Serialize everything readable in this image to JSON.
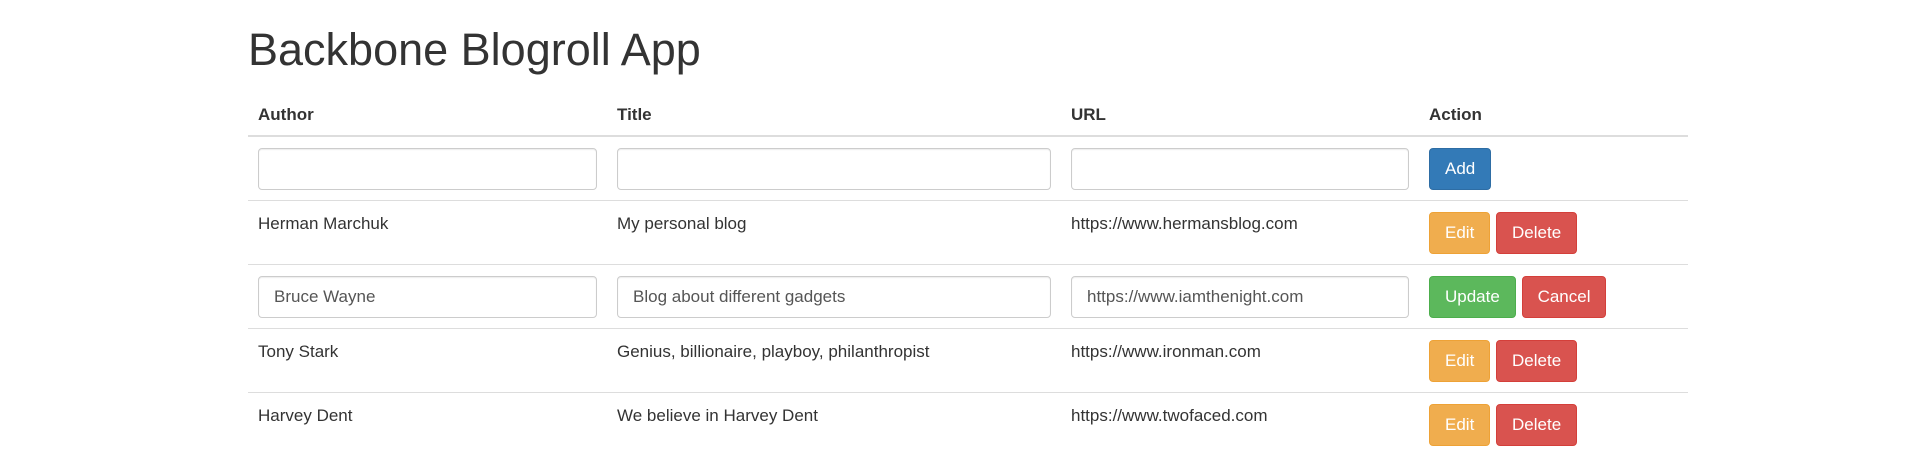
{
  "page": {
    "title": "Backbone Blogroll App"
  },
  "table": {
    "headers": {
      "author": "Author",
      "title": "Title",
      "url": "URL",
      "action": "Action"
    },
    "new_row": {
      "author_value": "",
      "title_value": "",
      "url_value": "",
      "add_label": "Add"
    },
    "rows": [
      {
        "mode": "view",
        "author": "Herman Marchuk",
        "title": "My personal blog",
        "url": "https://www.hermansblog.com",
        "edit_label": "Edit",
        "delete_label": "Delete"
      },
      {
        "mode": "edit",
        "author": "Bruce Wayne",
        "title": "Blog about different gadgets",
        "url": "https://www.iamthenight.com",
        "update_label": "Update",
        "cancel_label": "Cancel"
      },
      {
        "mode": "view",
        "author": "Tony Stark",
        "title": "Genius, billionaire, playboy, philanthropist",
        "url": "https://www.ironman.com",
        "edit_label": "Edit",
        "delete_label": "Delete"
      },
      {
        "mode": "view",
        "author": "Harvey Dent",
        "title": "We believe in Harvey Dent",
        "url": "https://www.twofaced.com",
        "edit_label": "Edit",
        "delete_label": "Delete"
      }
    ]
  },
  "colors": {
    "primary": "#337ab7",
    "warning": "#f0ad4e",
    "danger": "#d9534f",
    "success": "#5cb85c"
  }
}
